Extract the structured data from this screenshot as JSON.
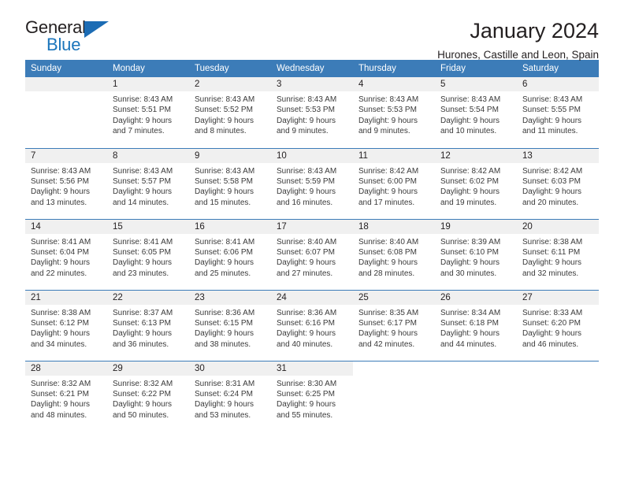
{
  "brand": {
    "name_part1": "General",
    "name_part2": "Blue",
    "triangle_color": "#1c6cb4",
    "blue_color": "#1b75bb"
  },
  "header": {
    "title": "January 2024",
    "subtitle": "Hurones, Castille and Leon, Spain"
  },
  "calendar": {
    "header_bg": "#3c7cb8",
    "daynum_bg": "#f0f0f0",
    "weekday_headers": [
      "Sunday",
      "Monday",
      "Tuesday",
      "Wednesday",
      "Thursday",
      "Friday",
      "Saturday"
    ],
    "weeks": [
      [
        {
          "day": "",
          "lines": []
        },
        {
          "day": "1",
          "lines": [
            "Sunrise: 8:43 AM",
            "Sunset: 5:51 PM",
            "Daylight: 9 hours",
            "and 7 minutes."
          ]
        },
        {
          "day": "2",
          "lines": [
            "Sunrise: 8:43 AM",
            "Sunset: 5:52 PM",
            "Daylight: 9 hours",
            "and 8 minutes."
          ]
        },
        {
          "day": "3",
          "lines": [
            "Sunrise: 8:43 AM",
            "Sunset: 5:53 PM",
            "Daylight: 9 hours",
            "and 9 minutes."
          ]
        },
        {
          "day": "4",
          "lines": [
            "Sunrise: 8:43 AM",
            "Sunset: 5:53 PM",
            "Daylight: 9 hours",
            "and 9 minutes."
          ]
        },
        {
          "day": "5",
          "lines": [
            "Sunrise: 8:43 AM",
            "Sunset: 5:54 PM",
            "Daylight: 9 hours",
            "and 10 minutes."
          ]
        },
        {
          "day": "6",
          "lines": [
            "Sunrise: 8:43 AM",
            "Sunset: 5:55 PM",
            "Daylight: 9 hours",
            "and 11 minutes."
          ]
        }
      ],
      [
        {
          "day": "7",
          "lines": [
            "Sunrise: 8:43 AM",
            "Sunset: 5:56 PM",
            "Daylight: 9 hours",
            "and 13 minutes."
          ]
        },
        {
          "day": "8",
          "lines": [
            "Sunrise: 8:43 AM",
            "Sunset: 5:57 PM",
            "Daylight: 9 hours",
            "and 14 minutes."
          ]
        },
        {
          "day": "9",
          "lines": [
            "Sunrise: 8:43 AM",
            "Sunset: 5:58 PM",
            "Daylight: 9 hours",
            "and 15 minutes."
          ]
        },
        {
          "day": "10",
          "lines": [
            "Sunrise: 8:43 AM",
            "Sunset: 5:59 PM",
            "Daylight: 9 hours",
            "and 16 minutes."
          ]
        },
        {
          "day": "11",
          "lines": [
            "Sunrise: 8:42 AM",
            "Sunset: 6:00 PM",
            "Daylight: 9 hours",
            "and 17 minutes."
          ]
        },
        {
          "day": "12",
          "lines": [
            "Sunrise: 8:42 AM",
            "Sunset: 6:02 PM",
            "Daylight: 9 hours",
            "and 19 minutes."
          ]
        },
        {
          "day": "13",
          "lines": [
            "Sunrise: 8:42 AM",
            "Sunset: 6:03 PM",
            "Daylight: 9 hours",
            "and 20 minutes."
          ]
        }
      ],
      [
        {
          "day": "14",
          "lines": [
            "Sunrise: 8:41 AM",
            "Sunset: 6:04 PM",
            "Daylight: 9 hours",
            "and 22 minutes."
          ]
        },
        {
          "day": "15",
          "lines": [
            "Sunrise: 8:41 AM",
            "Sunset: 6:05 PM",
            "Daylight: 9 hours",
            "and 23 minutes."
          ]
        },
        {
          "day": "16",
          "lines": [
            "Sunrise: 8:41 AM",
            "Sunset: 6:06 PM",
            "Daylight: 9 hours",
            "and 25 minutes."
          ]
        },
        {
          "day": "17",
          "lines": [
            "Sunrise: 8:40 AM",
            "Sunset: 6:07 PM",
            "Daylight: 9 hours",
            "and 27 minutes."
          ]
        },
        {
          "day": "18",
          "lines": [
            "Sunrise: 8:40 AM",
            "Sunset: 6:08 PM",
            "Daylight: 9 hours",
            "and 28 minutes."
          ]
        },
        {
          "day": "19",
          "lines": [
            "Sunrise: 8:39 AM",
            "Sunset: 6:10 PM",
            "Daylight: 9 hours",
            "and 30 minutes."
          ]
        },
        {
          "day": "20",
          "lines": [
            "Sunrise: 8:38 AM",
            "Sunset: 6:11 PM",
            "Daylight: 9 hours",
            "and 32 minutes."
          ]
        }
      ],
      [
        {
          "day": "21",
          "lines": [
            "Sunrise: 8:38 AM",
            "Sunset: 6:12 PM",
            "Daylight: 9 hours",
            "and 34 minutes."
          ]
        },
        {
          "day": "22",
          "lines": [
            "Sunrise: 8:37 AM",
            "Sunset: 6:13 PM",
            "Daylight: 9 hours",
            "and 36 minutes."
          ]
        },
        {
          "day": "23",
          "lines": [
            "Sunrise: 8:36 AM",
            "Sunset: 6:15 PM",
            "Daylight: 9 hours",
            "and 38 minutes."
          ]
        },
        {
          "day": "24",
          "lines": [
            "Sunrise: 8:36 AM",
            "Sunset: 6:16 PM",
            "Daylight: 9 hours",
            "and 40 minutes."
          ]
        },
        {
          "day": "25",
          "lines": [
            "Sunrise: 8:35 AM",
            "Sunset: 6:17 PM",
            "Daylight: 9 hours",
            "and 42 minutes."
          ]
        },
        {
          "day": "26",
          "lines": [
            "Sunrise: 8:34 AM",
            "Sunset: 6:18 PM",
            "Daylight: 9 hours",
            "and 44 minutes."
          ]
        },
        {
          "day": "27",
          "lines": [
            "Sunrise: 8:33 AM",
            "Sunset: 6:20 PM",
            "Daylight: 9 hours",
            "and 46 minutes."
          ]
        }
      ],
      [
        {
          "day": "28",
          "lines": [
            "Sunrise: 8:32 AM",
            "Sunset: 6:21 PM",
            "Daylight: 9 hours",
            "and 48 minutes."
          ]
        },
        {
          "day": "29",
          "lines": [
            "Sunrise: 8:32 AM",
            "Sunset: 6:22 PM",
            "Daylight: 9 hours",
            "and 50 minutes."
          ]
        },
        {
          "day": "30",
          "lines": [
            "Sunrise: 8:31 AM",
            "Sunset: 6:24 PM",
            "Daylight: 9 hours",
            "and 53 minutes."
          ]
        },
        {
          "day": "31",
          "lines": [
            "Sunrise: 8:30 AM",
            "Sunset: 6:25 PM",
            "Daylight: 9 hours",
            "and 55 minutes."
          ]
        },
        {
          "day": "",
          "lines": []
        },
        {
          "day": "",
          "lines": []
        },
        {
          "day": "",
          "lines": []
        }
      ]
    ]
  }
}
